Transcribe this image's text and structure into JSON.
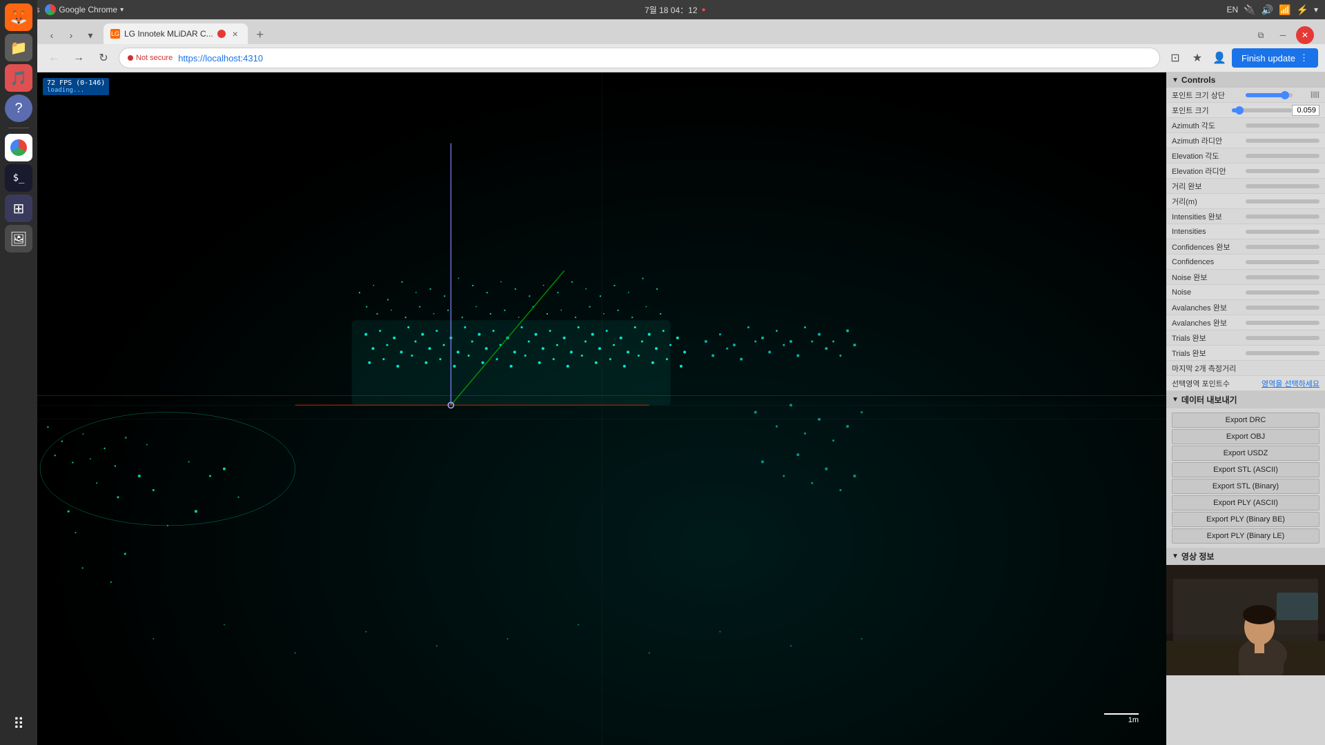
{
  "os_bar": {
    "activities": "Activities",
    "chrome_label": "Google Chrome",
    "datetime": "7월 18 04：12",
    "recording_dot": "●",
    "lang": "EN",
    "dropdown_arrow": "▾"
  },
  "browser": {
    "tab_label": "LG Innotek MLiDAR C...",
    "new_tab_title": "+",
    "back_title": "←",
    "forward_title": "→",
    "refresh_title": "↻",
    "security_label": "Not secure",
    "url": "https://localhost:4310",
    "finish_update": "Finish update",
    "finish_update_icon": "⋮"
  },
  "viewer": {
    "fps_label": "72 FPS (0-146)",
    "fps_sub": "loading...",
    "scale_label": "1m"
  },
  "controls": {
    "section_title": "Controls",
    "rows": [
      {
        "label": "포인트 크기",
        "has_slider": true,
        "slider_pct": 8,
        "value": "0.059"
      },
      {
        "label": "Azimuth 각도",
        "has_slider": true,
        "slider_pct": 0,
        "value": ""
      },
      {
        "label": "Azimuth 라디안",
        "has_slider": true,
        "slider_pct": 0,
        "value": ""
      },
      {
        "label": "Elevation 각도",
        "has_slider": true,
        "slider_pct": 0,
        "value": ""
      },
      {
        "label": "Elevation 라디안",
        "has_slider": true,
        "slider_pct": 0,
        "value": ""
      },
      {
        "label": "거리 완보",
        "has_slider": true,
        "slider_pct": 0,
        "value": ""
      },
      {
        "label": "거리(m)",
        "has_slider": true,
        "slider_pct": 0,
        "value": ""
      },
      {
        "label": "Intensities 완보",
        "has_slider": true,
        "slider_pct": 0,
        "value": ""
      },
      {
        "label": "Intensities",
        "has_slider": true,
        "slider_pct": 0,
        "value": ""
      },
      {
        "label": "Confidences 완보",
        "has_slider": true,
        "slider_pct": 0,
        "value": ""
      },
      {
        "label": "Confidences",
        "has_slider": true,
        "slider_pct": 0,
        "value": ""
      },
      {
        "label": "Noise 완보",
        "has_slider": true,
        "slider_pct": 0,
        "value": ""
      },
      {
        "label": "Noise",
        "has_slider": true,
        "slider_pct": 0,
        "value": ""
      },
      {
        "label": "Avalanches 완보",
        "has_slider": true,
        "slider_pct": 0,
        "value": ""
      },
      {
        "label": "Avalanches 완보",
        "has_slider": true,
        "slider_pct": 0,
        "value": ""
      },
      {
        "label": "Trials 완보",
        "has_slider": true,
        "slider_pct": 0,
        "value": ""
      },
      {
        "label": "Trials 완보",
        "has_slider": true,
        "slider_pct": 0,
        "value": ""
      },
      {
        "label": "마지막 2개 측정거리",
        "has_slider": false,
        "value": ""
      },
      {
        "label": "선택영역 포인트수",
        "has_link": true,
        "link_text": "영역을 선택하세요",
        "value": ""
      }
    ],
    "export_section_title": "데이터 내보내기",
    "export_buttons": [
      "Export DRC",
      "Export OBJ",
      "Export USDZ",
      "Export STL (ASCII)",
      "Export STL (Binary)",
      "Export PLY (ASCII)",
      "Export PLY (Binary BE)",
      "Export PLY (Binary LE)"
    ],
    "camera_section_title": "영상 정보"
  },
  "dock": {
    "icons": [
      {
        "name": "firefox",
        "label": "🦊"
      },
      {
        "name": "files",
        "label": "📁"
      },
      {
        "name": "rhythmbox",
        "label": "🎵"
      },
      {
        "name": "help",
        "label": "?"
      },
      {
        "name": "chrome",
        "label": "⊙"
      },
      {
        "name": "terminal",
        "label": ">"
      },
      {
        "name": "screenshot",
        "label": "⊞"
      },
      {
        "name": "image-viewer",
        "label": "🖼"
      }
    ],
    "apps_icon": "⠿"
  }
}
